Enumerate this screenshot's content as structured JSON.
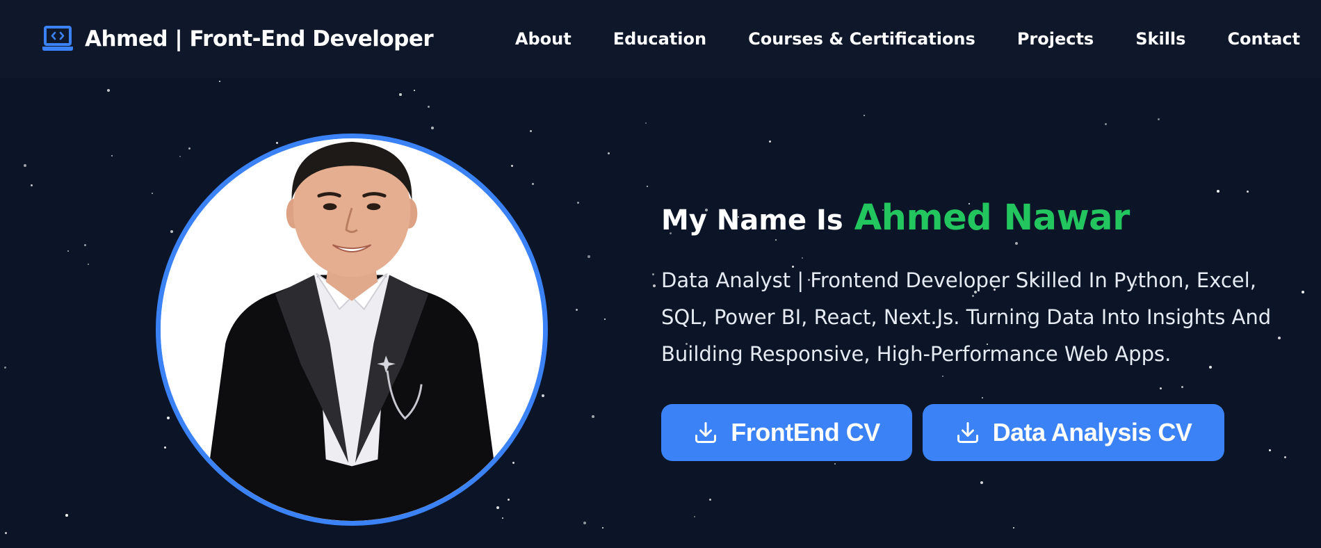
{
  "brand": {
    "name": "Ahmed | Front-End Developer",
    "icon": "laptop-code-icon",
    "accent_color": "#3b82f6"
  },
  "nav": {
    "items": [
      {
        "label": "About"
      },
      {
        "label": "Education"
      },
      {
        "label": "Courses & Certifications"
      },
      {
        "label": "Projects"
      },
      {
        "label": "Skills"
      },
      {
        "label": "Contact"
      }
    ]
  },
  "hero": {
    "greeting_prefix": "My Name Is",
    "name": "Ahmed Nawar",
    "name_color": "#22c55e",
    "bio": "Data Analyst | Frontend Developer Skilled In Python, Excel, SQL, Power BI, React, Next.Js. Turning Data Into Insights And Building Responsive, High-Performance Web Apps.",
    "buttons": [
      {
        "label": "FrontEnd CV",
        "icon": "download-icon"
      },
      {
        "label": "Data Analysis CV",
        "icon": "download-icon"
      }
    ],
    "button_color": "#3b82f6",
    "photo_border_color": "#3b82f6",
    "background_color": "#0b1527"
  }
}
